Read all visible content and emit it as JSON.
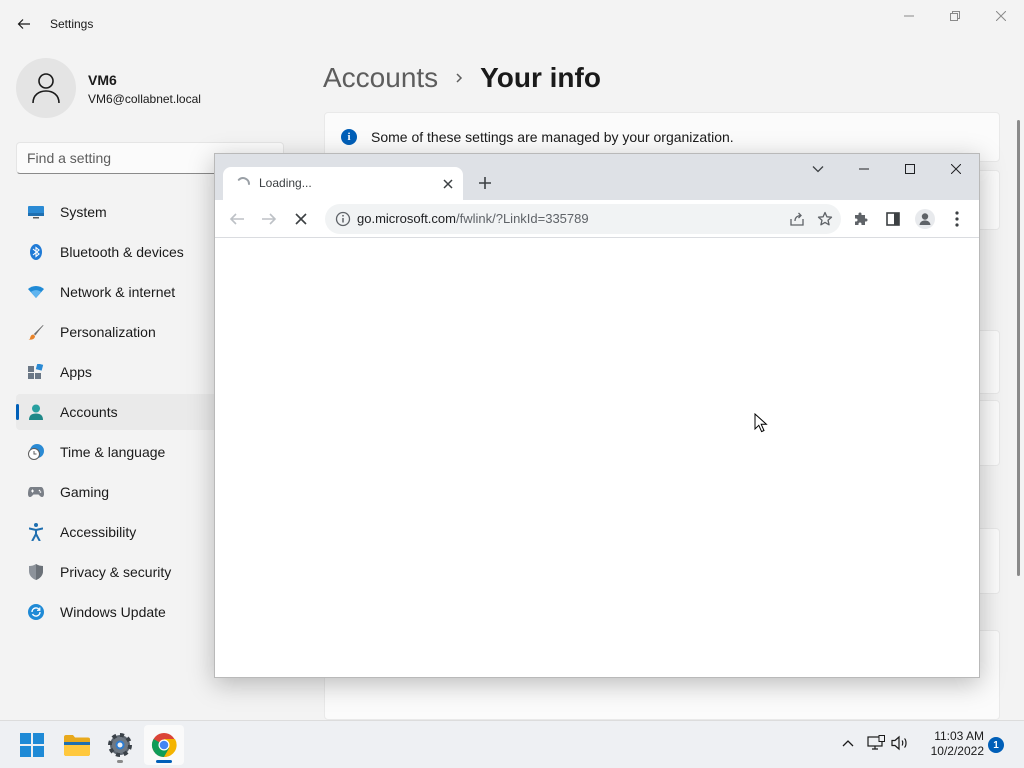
{
  "settings": {
    "app_title": "Settings",
    "profile": {
      "name": "VM6",
      "email": "VM6@collabnet.local"
    },
    "search_placeholder": "Find a setting",
    "nav": [
      {
        "label": "System",
        "icon": "monitor-icon"
      },
      {
        "label": "Bluetooth & devices",
        "icon": "bluetooth-icon"
      },
      {
        "label": "Network & internet",
        "icon": "wifi-icon"
      },
      {
        "label": "Personalization",
        "icon": "brush-icon"
      },
      {
        "label": "Apps",
        "icon": "apps-icon"
      },
      {
        "label": "Accounts",
        "icon": "person-icon",
        "active": true
      },
      {
        "label": "Time & language",
        "icon": "clock-globe-icon"
      },
      {
        "label": "Gaming",
        "icon": "gamepad-icon"
      },
      {
        "label": "Accessibility",
        "icon": "accessibility-icon"
      },
      {
        "label": "Privacy & security",
        "icon": "shield-icon"
      },
      {
        "label": "Windows Update",
        "icon": "update-icon"
      }
    ],
    "breadcrumb": {
      "parent": "Accounts",
      "current": "Your info"
    },
    "info_message": "Some of these settings are managed by your organization."
  },
  "browser": {
    "tab_title": "Loading...",
    "url_host": "go.microsoft.com",
    "url_path": "/fwlink/?LinkId=335789"
  },
  "taskbar": {
    "time": "11:03 AM",
    "date": "10/2/2022",
    "notification_count": "1"
  },
  "colors": {
    "accent": "#005fb8",
    "settings_bg": "#f3f3f3",
    "chrome_frame": "#dee1e6"
  }
}
